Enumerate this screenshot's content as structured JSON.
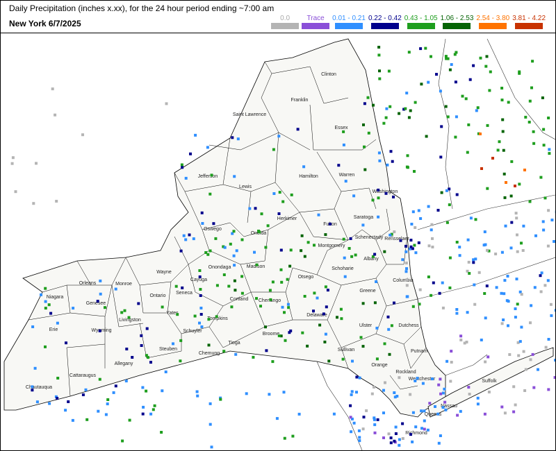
{
  "header": {
    "title": "Daily Precipitation (inches  x.xx),  for the 24 hour period ending ~7:00 am",
    "subtitle": "New York 6/7/2025"
  },
  "legend": [
    {
      "label": "0.0",
      "color": "#b4b4b4"
    },
    {
      "label": "Trace",
      "color": "#8a4fd8"
    },
    {
      "label": "0.01 - 0.21",
      "color": "#2f8fff"
    },
    {
      "label": "0.22 - 0.42",
      "color": "#00008c"
    },
    {
      "label": "0.43 - 1.05",
      "color": "#1e9e1e"
    },
    {
      "label": "1.06 - 2.53",
      "color": "#056405"
    },
    {
      "label": "2.54 - 3.80",
      "color": "#ff7300"
    },
    {
      "label": "3.81 - 4.22",
      "color": "#c83200"
    }
  ],
  "counties": [
    "Clinton",
    "Franklin",
    "Essex",
    "Saint Lawrence",
    "Jefferson",
    "Lewis",
    "Hamilton",
    "Warren",
    "Washington",
    "Herkimer",
    "Fulton",
    "Saratoga",
    "Oswego",
    "Oneida",
    "Schenectady",
    "Rensselaer",
    "Montgomery",
    "Albany",
    "Madison",
    "Onondaga",
    "Cayuga",
    "Wayne",
    "Orleans",
    "Niagara",
    "Monroe",
    "Genesee",
    "Ontario",
    "Seneca",
    "Livingston",
    "Wyoming",
    "Erie",
    "Yates",
    "Schuyler",
    "Cortland",
    "Chenango",
    "Otsego",
    "Schoharie",
    "Greene",
    "Columbia",
    "Delaware",
    "Ulster",
    "Dutchess",
    "Broome",
    "Tioga",
    "Chemung",
    "Steuben",
    "Allegany",
    "Cattaraugus",
    "Chautauqua",
    "Tompkins",
    "Sullivan",
    "Orange",
    "Putnam",
    "Rockland",
    "Westchester",
    "Suffolk",
    "Nassau",
    "Queens",
    "Richmond"
  ]
}
